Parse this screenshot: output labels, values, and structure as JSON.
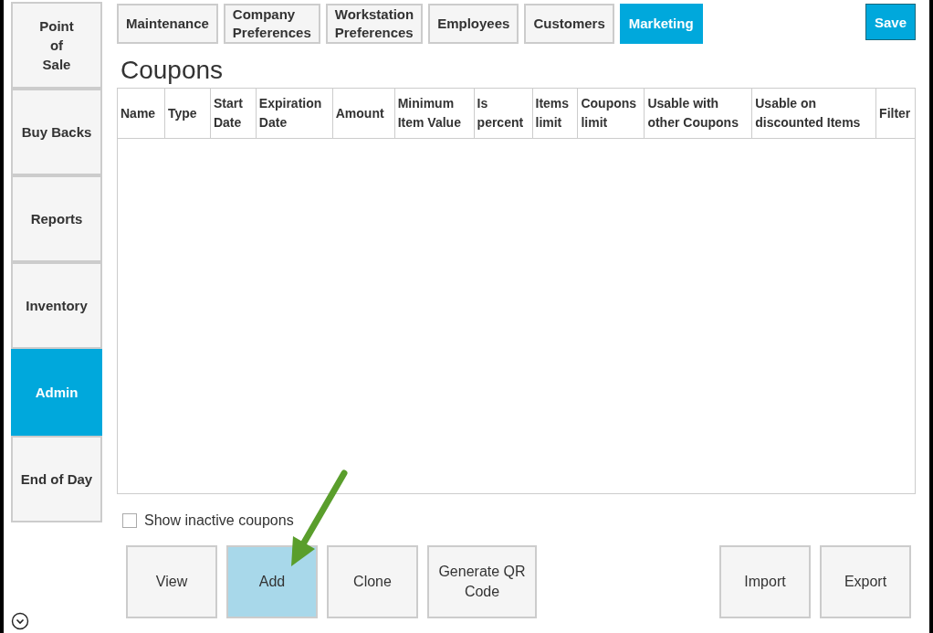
{
  "sidebar": {
    "items": [
      {
        "label": "Point\nof\nSale",
        "selected": false
      },
      {
        "label": "Buy Backs",
        "selected": false
      },
      {
        "label": "Reports",
        "selected": false
      },
      {
        "label": "Inventory",
        "selected": false
      },
      {
        "label": "Admin",
        "selected": true
      },
      {
        "label": "End of Day",
        "selected": false
      }
    ]
  },
  "tabs": [
    {
      "label": "Maintenance",
      "selected": false
    },
    {
      "label": "Company\nPreferences",
      "selected": false
    },
    {
      "label": "Workstation\nPreferences",
      "selected": false
    },
    {
      "label": "Employees",
      "selected": false
    },
    {
      "label": "Customers",
      "selected": false
    },
    {
      "label": "Marketing",
      "selected": true
    }
  ],
  "save_button": "Save",
  "title": "Coupons",
  "table": {
    "columns": [
      "Name",
      "Type",
      "Start\nDate",
      "Expiration\nDate",
      "Amount",
      "Minimum\nItem Value",
      "Is\npercent",
      "Items\nlimit",
      "Coupons\nlimit",
      "Usable with\nother Coupons",
      "Usable on\ndiscounted Items",
      "Filter"
    ]
  },
  "show_inactive": {
    "label": "Show inactive coupons",
    "checked": false
  },
  "buttons_left": [
    {
      "label": "View",
      "selected": false
    },
    {
      "label": "Add",
      "selected": true
    },
    {
      "label": "Clone",
      "selected": false
    },
    {
      "label": "Generate QR\nCode",
      "selected": false
    }
  ],
  "buttons_right": [
    {
      "label": "Import",
      "selected": false
    },
    {
      "label": "Export",
      "selected": false
    }
  ]
}
